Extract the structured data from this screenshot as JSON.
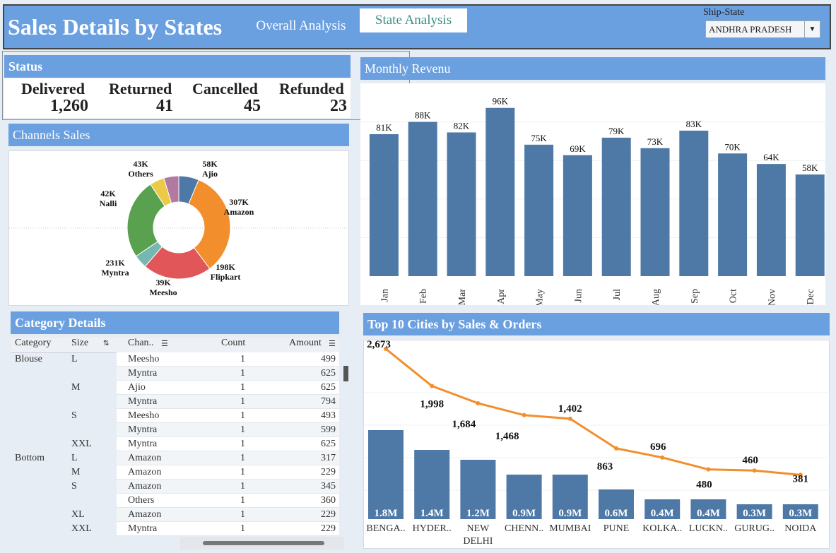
{
  "header": {
    "title": "Sales Details by States",
    "tabs": [
      {
        "label": "Overall Analysis"
      },
      {
        "label": "State Analysis"
      }
    ],
    "filter_label": "Ship-State",
    "filter_value": "ANDHRA PRADESH"
  },
  "status": {
    "title": "Status",
    "items": [
      {
        "label": "Delivered",
        "value": "1,260"
      },
      {
        "label": "Returned",
        "value": "41"
      },
      {
        "label": "Cancelled",
        "value": "45"
      },
      {
        "label": "Refunded",
        "value": "23"
      }
    ]
  },
  "channels": {
    "title": "Channels Sales",
    "slices": [
      {
        "name": "Ajio",
        "label": "58K",
        "value": 58,
        "color": "#4e79a7"
      },
      {
        "name": "Amazon",
        "label": "307K",
        "value": 307,
        "color": "#f28e2b"
      },
      {
        "name": "Flipkart",
        "label": "198K",
        "value": 198,
        "color": "#e15759"
      },
      {
        "name": "Meesho",
        "label": "39K",
        "value": 39,
        "color": "#76b7b2"
      },
      {
        "name": "Myntra",
        "label": "231K",
        "value": 231,
        "color": "#59a14f"
      },
      {
        "name": "Nalli",
        "label": "42K",
        "value": 42,
        "color": "#edc948"
      },
      {
        "name": "Others",
        "label": "43K",
        "value": 43,
        "color": "#b07aa1"
      }
    ]
  },
  "revenue": {
    "title": "Monthly Revenu",
    "bar_color": "#4e79a7"
  },
  "category": {
    "title": "Category Details",
    "headers": {
      "category": "Category",
      "size": "Size",
      "channel": "Chan..",
      "count": "Count",
      "amount": "Amount"
    },
    "rows": [
      {
        "category": "Blouse",
        "size": "L",
        "channel": "Meesho",
        "count": "1",
        "amount": "499"
      },
      {
        "category": "",
        "size": "",
        "channel": "Myntra",
        "count": "1",
        "amount": "625"
      },
      {
        "category": "",
        "size": "M",
        "channel": "Ajio",
        "count": "1",
        "amount": "625"
      },
      {
        "category": "",
        "size": "",
        "channel": "Myntra",
        "count": "1",
        "amount": "794"
      },
      {
        "category": "",
        "size": "S",
        "channel": "Meesho",
        "count": "1",
        "amount": "493"
      },
      {
        "category": "",
        "size": "",
        "channel": "Myntra",
        "count": "1",
        "amount": "599"
      },
      {
        "category": "",
        "size": "XXL",
        "channel": "Myntra",
        "count": "1",
        "amount": "625"
      },
      {
        "category": "Bottom",
        "size": "L",
        "channel": "Amazon",
        "count": "1",
        "amount": "317"
      },
      {
        "category": "",
        "size": "M",
        "channel": "Amazon",
        "count": "1",
        "amount": "229"
      },
      {
        "category": "",
        "size": "S",
        "channel": "Amazon",
        "count": "1",
        "amount": "345"
      },
      {
        "category": "",
        "size": "",
        "channel": "Others",
        "count": "1",
        "amount": "360"
      },
      {
        "category": "",
        "size": "XL",
        "channel": "Amazon",
        "count": "1",
        "amount": "229"
      },
      {
        "category": "",
        "size": "XXL",
        "channel": "Myntra",
        "count": "1",
        "amount": "229"
      }
    ]
  },
  "cities": {
    "title": "Top 10 Cities by Sales & Orders",
    "bar_color": "#4e79a7",
    "line_color": "#f28e2b"
  },
  "chart_data": [
    {
      "type": "bar",
      "title": "Monthly Revenu",
      "categories": [
        "Jan",
        "Feb",
        "Mar",
        "Apr",
        "May",
        "Jun",
        "Jul",
        "Aug",
        "Sep",
        "Oct",
        "Nov",
        "Dec"
      ],
      "values": [
        81,
        88,
        82,
        96,
        75,
        69,
        79,
        73,
        83,
        70,
        64,
        58
      ],
      "labels": [
        "81K",
        "88K",
        "82K",
        "96K",
        "75K",
        "69K",
        "79K",
        "73K",
        "83K",
        "70K",
        "64K",
        "58K"
      ],
      "ylim": [
        0,
        110
      ]
    },
    {
      "type": "pie",
      "title": "Channels Sales",
      "categories": [
        "Ajio",
        "Amazon",
        "Flipkart",
        "Meesho",
        "Myntra",
        "Nalli",
        "Others"
      ],
      "values": [
        58,
        307,
        198,
        39,
        231,
        42,
        43
      ]
    },
    {
      "type": "bar",
      "title": "Top 10 Cities by Sales & Orders",
      "categories": [
        "BENGA..",
        "HYDER..",
        "NEW DELHI",
        "CHENN..",
        "MUMBAI",
        "PUNE",
        "KOLKA..",
        "LUCKN..",
        "GURUG..",
        "NOIDA"
      ],
      "series": [
        {
          "values": [
            1.8,
            1.4,
            1.2,
            0.9,
            0.9,
            0.6,
            0.4,
            0.4,
            0.3,
            0.3
          ],
          "labels": [
            "1.8M",
            "1.4M",
            "1.2M",
            "0.9M",
            "0.9M",
            "0.6M",
            "0.4M",
            "0.4M",
            "0.3M",
            "0.3M"
          ]
        },
        {
          "values": [
            2673,
            1998,
            1684,
            1468,
            1402,
            863,
            696,
            480,
            460,
            381
          ],
          "labels": [
            "2,673",
            "1,998",
            "1,684",
            "1,468",
            "1,402",
            "863",
            "696",
            "480",
            "460",
            "381"
          ]
        }
      ]
    }
  ]
}
